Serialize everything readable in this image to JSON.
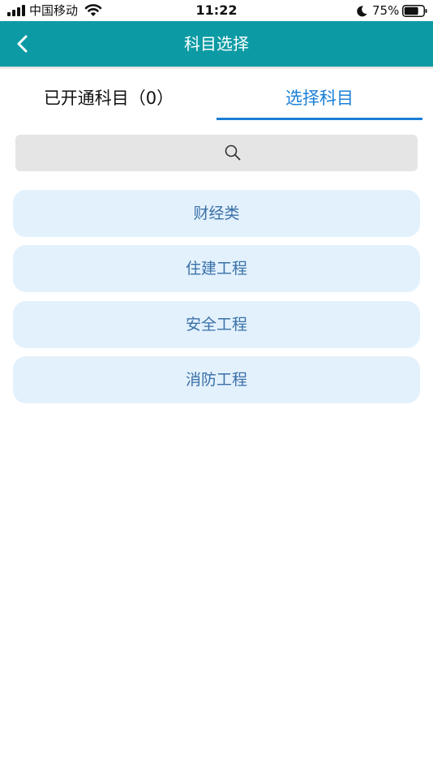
{
  "status_bar": {
    "carrier": "中国移动",
    "time": "11:22",
    "battery_percent": "75%",
    "battery_level": 0.75,
    "icons": [
      "signal-icon",
      "wifi-icon",
      "moon-icon",
      "battery-icon"
    ]
  },
  "nav": {
    "title": "科目选择",
    "back_icon": "chevron-left-icon"
  },
  "tabs": [
    {
      "label": "已开通科目（0）",
      "active": false
    },
    {
      "label": "选择科目",
      "active": true
    }
  ],
  "search": {
    "icon": "search-icon",
    "placeholder": ""
  },
  "categories": [
    {
      "label": "财经类"
    },
    {
      "label": "住建工程"
    },
    {
      "label": "安全工程"
    },
    {
      "label": "消防工程"
    }
  ],
  "colors": {
    "nav_background": "#0c9ba4",
    "accent": "#1a7fd6",
    "category_background": "#e3f1fd",
    "category_text": "#3a70a8",
    "search_background": "#e5e5e5"
  }
}
